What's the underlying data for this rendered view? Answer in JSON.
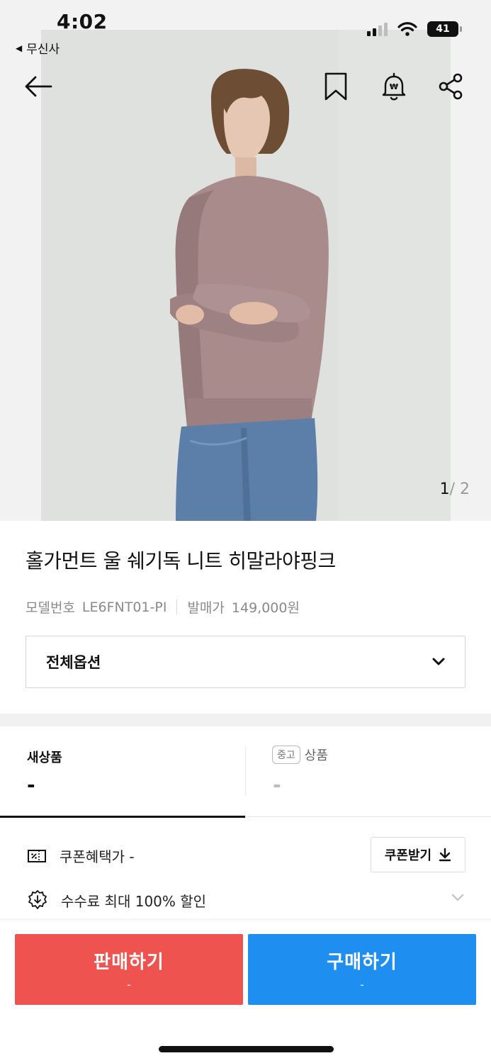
{
  "status_bar": {
    "time": "4:02",
    "back_app": "무신사",
    "battery": "41"
  },
  "nav": {
    "back_icon": "arrow-left-icon",
    "bookmark_icon": "bookmark-icon",
    "price_alert_icon": "won-bell-icon",
    "share_icon": "share-icon"
  },
  "gallery": {
    "current": "1",
    "separator": "/",
    "total": "2"
  },
  "product": {
    "title": "홀가먼트 울 쉐기독 니트 히말라야핑크",
    "model_label": "모델번호",
    "model_value": "LE6FNT01-PI",
    "release_price_label": "발매가",
    "release_price_value": "149,000원"
  },
  "options": {
    "label": "전체옵션"
  },
  "condition_tabs": {
    "new_label": "새상품",
    "new_price": "-",
    "used_chip": "중고",
    "used_label": "상품",
    "used_price": "-"
  },
  "benefits": {
    "coupon_text": "쿠폰혜택가 -",
    "coupon_button": "쿠폰받기",
    "fee_text": "수수료 최대 100% 할인"
  },
  "actions": {
    "sell_label": "판매하기",
    "sell_price": "-",
    "buy_label": "구매하기",
    "buy_price": "-"
  },
  "colors": {
    "sell": "#ef5350",
    "buy": "#1e8ff1",
    "text": "#111111",
    "muted": "#8a8a8a"
  }
}
